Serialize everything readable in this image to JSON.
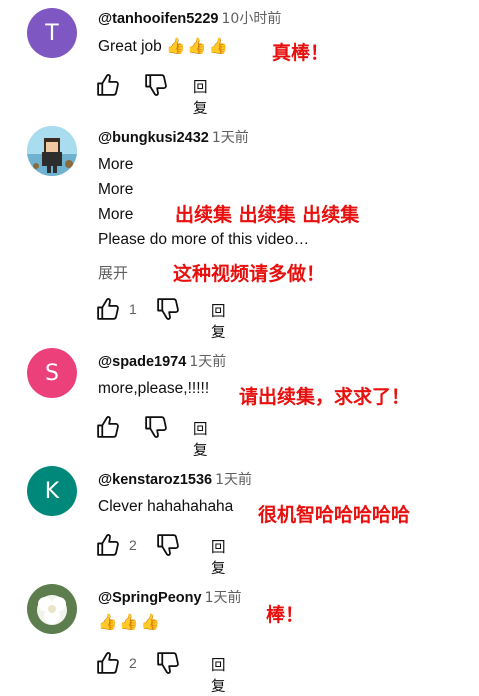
{
  "comments": [
    {
      "handle": "@tanhooifen5229",
      "time": "10小时前",
      "avatar_letter": "T",
      "avatar_color": "#7e57c2",
      "lines": [
        "Great job"
      ],
      "thumbs": "👍👍👍",
      "annotation": "真棒！",
      "like_count": "",
      "reply_label": "回复"
    },
    {
      "handle": "@bungkusi2432",
      "time": "1天前",
      "avatar_letter": "",
      "avatar_color": "#8fd0e8",
      "lines": [
        "More",
        "More",
        "More",
        "Please do more of this video…"
      ],
      "expand_label": "展开",
      "annotation_1": "出续集 出续集 出续集",
      "annotation_2": "这种视频请多做！",
      "like_count": "1",
      "reply_label": "回复"
    },
    {
      "handle": "@spade1974",
      "time": "1天前",
      "avatar_letter": "S",
      "avatar_color": "#ec407a",
      "lines": [
        "more,please,!!!!!"
      ],
      "annotation": "请出续集，求求了！",
      "like_count": "",
      "reply_label": "回复"
    },
    {
      "handle": "@kenstaroz1536",
      "time": "1天前",
      "avatar_letter": "K",
      "avatar_color": "#00897b",
      "lines": [
        "Clever hahahahaha"
      ],
      "annotation": "很机智哈哈哈哈哈",
      "like_count": "2",
      "reply_label": "回复"
    },
    {
      "handle": "@SpringPeony",
      "time": "1天前",
      "avatar_letter": "",
      "avatar_color": "#6a8a5a",
      "lines": [],
      "thumbs": "👍👍👍",
      "annotation": "棒！",
      "like_count": "2",
      "reply_label": "回复"
    }
  ],
  "icons": {
    "like": "thumbs-up-icon",
    "dislike": "thumbs-down-icon"
  }
}
